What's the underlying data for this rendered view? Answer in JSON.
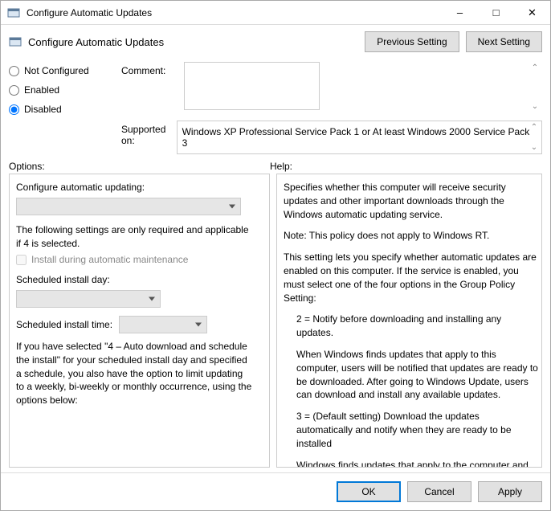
{
  "titlebar": {
    "title": "Configure Automatic Updates"
  },
  "header": {
    "title": "Configure Automatic Updates",
    "prev": "Previous Setting",
    "next": "Next Setting"
  },
  "radios": {
    "notconfigured": "Not Configured",
    "enabled": "Enabled",
    "disabled": "Disabled",
    "selected": "disabled"
  },
  "fields": {
    "comment_label": "Comment:",
    "comment_value": "",
    "supported_label": "Supported on:",
    "supported_value": "Windows XP Professional Service Pack 1 or At least Windows 2000 Service Pack 3"
  },
  "panel_heads": {
    "options": "Options:",
    "help": "Help:"
  },
  "options": {
    "l1": "Configure automatic updating:",
    "l2": "The following settings are only required and applicable if 4 is selected.",
    "chk": "Install during automatic maintenance",
    "l3": "Scheduled install day:",
    "l4": "Scheduled install time:",
    "l5": "If you have selected \"4 – Auto download and schedule the install\" for your scheduled install day and specified a schedule, you also have the option to limit updating to a weekly, bi-weekly or monthly occurrence, using the options below:"
  },
  "help": {
    "p1": "Specifies whether this computer will receive security updates and other important downloads through the Windows automatic updating service.",
    "p2": "Note: This policy does not apply to Windows RT.",
    "p3": "This setting lets you specify whether automatic updates are enabled on this computer. If the service is enabled, you must select one of the four options in the Group Policy Setting:",
    "p4": "2 = Notify before downloading and installing any updates.",
    "p5": "When Windows finds updates that apply to this computer, users will be notified that updates are ready to be downloaded. After going to Windows Update, users can download and install any available updates.",
    "p6": "3 = (Default setting) Download the updates automatically and notify when they are ready to be installed",
    "p7": "Windows finds updates that apply to the computer and"
  },
  "footer": {
    "ok": "OK",
    "cancel": "Cancel",
    "apply": "Apply"
  }
}
